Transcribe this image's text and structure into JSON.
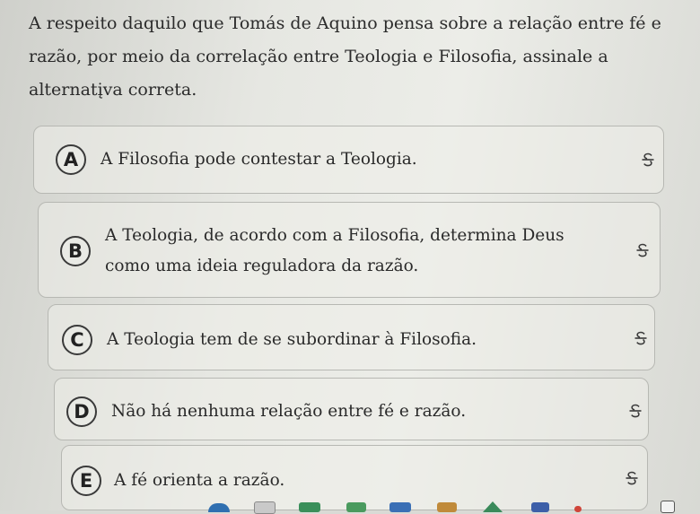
{
  "question": {
    "text": "A respeito daquilo que Tomás de Aquino pensa sobre a relação entre fé e razão, por meio da correlação entre Teologia e Filosofia, assinale a alternatįva correta."
  },
  "options": [
    {
      "letter": "A",
      "text": "A Filosofia pode contestar a Teologia."
    },
    {
      "letter": "B",
      "text": "A Teologia, de acordo com a Filosofia, determina Deus como uma ideia reguladora da razão."
    },
    {
      "letter": "C",
      "text": "A Teologia tem de se subordinar à Filosofia."
    },
    {
      "letter": "D",
      "text": "Não há nenhuma relação entre fé e razão."
    },
    {
      "letter": "E",
      "text": "A fé orienta a razão."
    }
  ],
  "icons": {
    "strikethrough": "strikethrough-icon"
  },
  "colors": {
    "text": "#2a2a2a",
    "border": "#b7b8b3",
    "background": "#e6e7e2"
  }
}
